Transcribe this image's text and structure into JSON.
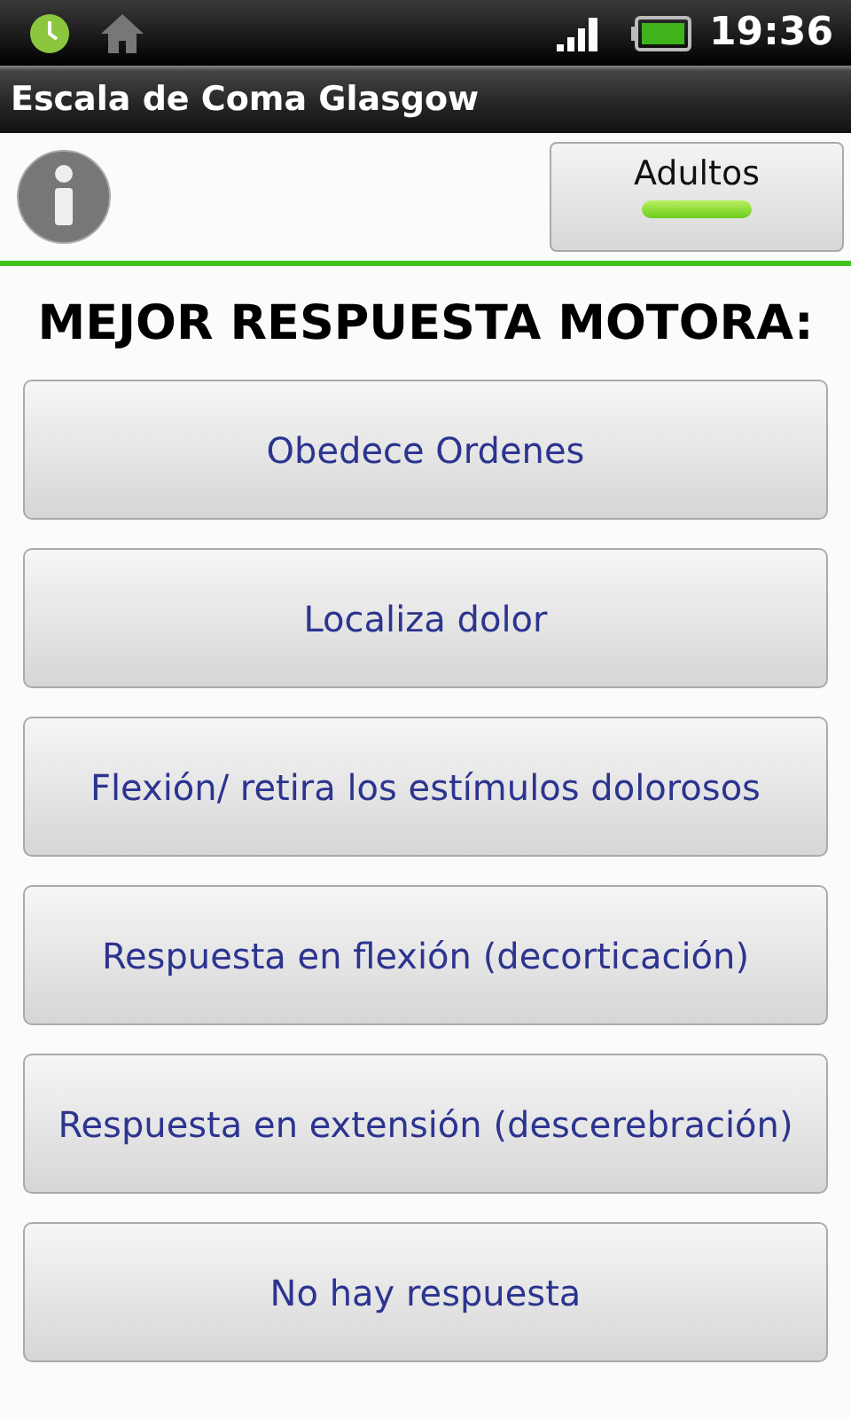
{
  "status_bar": {
    "time": "19:36"
  },
  "window": {
    "title": "Escala de Coma Glasgow"
  },
  "toggle": {
    "label": "Adultos",
    "on": true
  },
  "heading": "MEJOR RESPUESTA MOTORA:",
  "options": [
    {
      "label": "Obedece Ordenes"
    },
    {
      "label": "Localiza dolor"
    },
    {
      "label": "Flexión/ retira los estímulos dolorosos"
    },
    {
      "label": "Respuesta en flexión (decorticación)"
    },
    {
      "label": "Respuesta en extensión (descerebración)"
    },
    {
      "label": "No hay respuesta"
    }
  ]
}
